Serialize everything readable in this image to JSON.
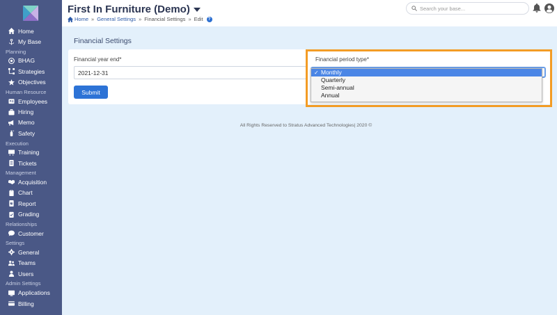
{
  "sidebar": {
    "groups": [
      {
        "section": "",
        "items": [
          {
            "label": "Home",
            "icon": "home-icon"
          },
          {
            "label": "My Base",
            "icon": "anchor-icon"
          }
        ]
      },
      {
        "section": "Planning",
        "items": [
          {
            "label": "BHAG",
            "icon": "target-icon"
          },
          {
            "label": "Strategies",
            "icon": "strategies-icon"
          },
          {
            "label": "Objectives",
            "icon": "star-icon"
          }
        ]
      },
      {
        "section": "Human Resource",
        "items": [
          {
            "label": "Employees",
            "icon": "id-card-icon"
          },
          {
            "label": "Hiring",
            "icon": "hiring-icon"
          },
          {
            "label": "Memo",
            "icon": "megaphone-icon"
          },
          {
            "label": "Safety",
            "icon": "fire-extinguisher-icon"
          }
        ]
      },
      {
        "section": "Execution",
        "items": [
          {
            "label": "Training",
            "icon": "chalkboard-icon"
          },
          {
            "label": "Tickets",
            "icon": "ticket-icon"
          }
        ]
      },
      {
        "section": "Management",
        "items": [
          {
            "label": "Acquisition",
            "icon": "handshake-icon"
          },
          {
            "label": "Chart",
            "icon": "clipboard-icon"
          },
          {
            "label": "Report",
            "icon": "report-icon"
          },
          {
            "label": "Grading",
            "icon": "grading-icon"
          }
        ]
      },
      {
        "section": "Relationships",
        "items": [
          {
            "label": "Customer",
            "icon": "chat-icon"
          }
        ]
      },
      {
        "section": "Settings",
        "items": [
          {
            "label": "General",
            "icon": "gear-icon"
          },
          {
            "label": "Teams",
            "icon": "teams-icon"
          },
          {
            "label": "Users",
            "icon": "users-icon"
          }
        ]
      },
      {
        "section": "Admin Settings",
        "items": [
          {
            "label": "Applications",
            "icon": "applications-icon"
          },
          {
            "label": "Billing",
            "icon": "billing-icon"
          }
        ]
      }
    ]
  },
  "header": {
    "title": "First In Furniture (Demo)",
    "breadcrumb": {
      "home": "Home",
      "general": "General Settings",
      "sep": "»",
      "financial": "Financial Settings",
      "edit": "Edit",
      "help": "?"
    },
    "search_placeholder": "Search your base..."
  },
  "main": {
    "page_title": "Financial Settings",
    "year_end_label": "Financial year end*",
    "year_end_value": "2021-12-31",
    "period_label": "Financial period type*",
    "period_options": [
      "Monthly",
      "Quarterly",
      "Semi-annual",
      "Annual"
    ],
    "period_selected": "Monthly",
    "check_mark": "✓",
    "submit_label": "Submit"
  },
  "footer": {
    "text": "All Rights Reserved to Stratus Advanced Technologies| 2020 ©"
  },
  "colors": {
    "sidebar": "#4a5886",
    "accent": "#2d73d6",
    "highlight": "#f39c25",
    "background": "#e3f0fb"
  }
}
